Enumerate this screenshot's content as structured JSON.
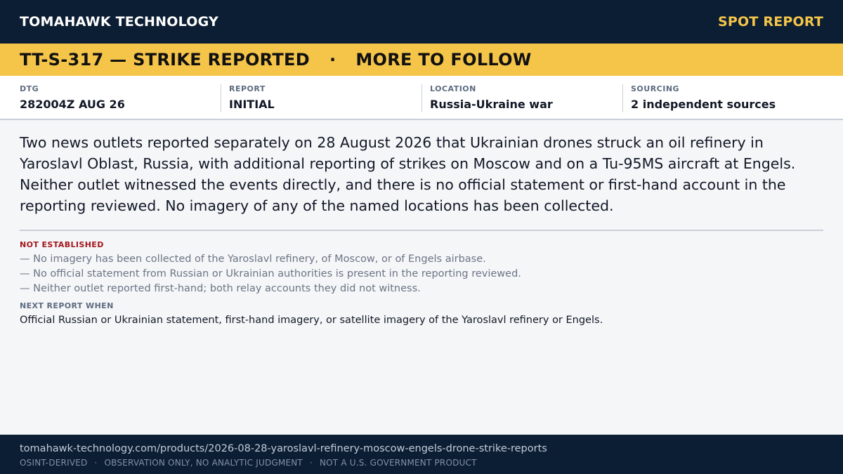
{
  "header": {
    "brand": "TOMAHAWK TECHNOLOGY",
    "report_type": "SPOT REPORT",
    "brand_color": "#0c1e33",
    "accent_color": "#f5c54a"
  },
  "banner": {
    "headline": "TT-S-317 — STRIKE REPORTED",
    "separator": "·",
    "status": "MORE TO FOLLOW"
  },
  "meta": [
    {
      "label": "DTG",
      "value": "282004Z AUG 26"
    },
    {
      "label": "REPORT",
      "value": "INITIAL"
    },
    {
      "label": "LOCATION",
      "value": "Russia-Ukraine war"
    },
    {
      "label": "SOURCING",
      "value": "2 independent sources"
    }
  ],
  "summary": "Two news outlets reported separately on 28 August 2026 that Ukrainian drones struck an oil refinery in Yaroslavl Oblast, Russia, with additional reporting of strikes on Moscow and on a Tu-95MS aircraft at Engels. Neither outlet witnessed the events directly, and there is no official statement or first-hand account in the reporting reviewed. No imagery of any of the named locations has been collected.",
  "not_established": {
    "label": "NOT ESTABLISHED",
    "label_color": "#a3171d",
    "items": [
      "— No imagery has been collected of the Yaroslavl refinery, of Moscow, or of Engels airbase.",
      "— No official statement from Russian or Ukrainian authorities is present in the reporting reviewed.",
      "— Neither outlet reported first-hand; both relay accounts they did not witness."
    ]
  },
  "next_report": {
    "label": "NEXT REPORT WHEN",
    "text": "Official Russian or Ukrainian statement, first-hand imagery, or satellite imagery of the Yaroslavl refinery or Engels."
  },
  "footer": {
    "url": "tomahawk-technology.com/products/2026-08-28-yaroslavl-refinery-moscow-engels-drone-strike-reports",
    "disclaimers": [
      "OSINT-DERIVED",
      "OBSERVATION ONLY, NO ANALYTIC JUDGMENT",
      "NOT A U.S. GOVERNMENT PRODUCT"
    ],
    "separator": "·"
  }
}
